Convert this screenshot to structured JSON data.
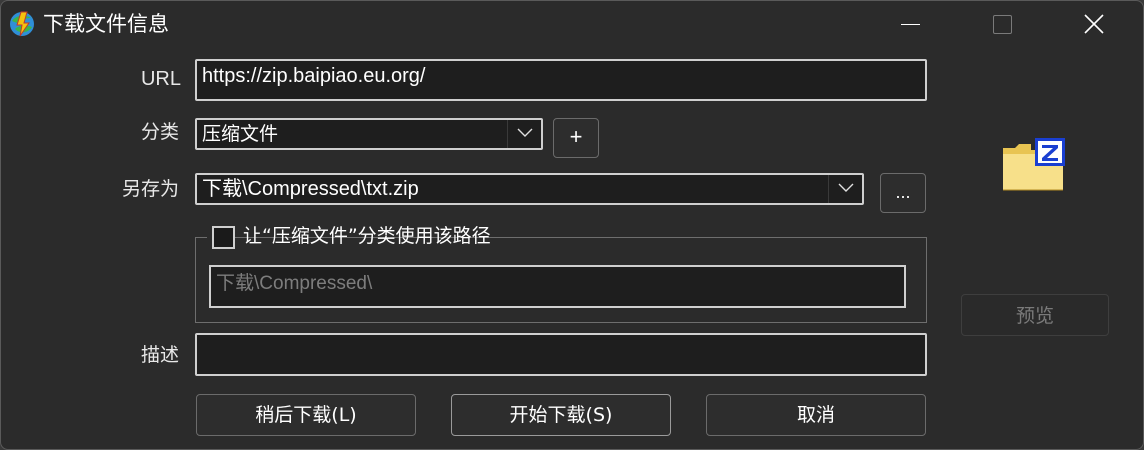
{
  "window": {
    "title": "下载文件信息",
    "icon": "idm-globe-icon"
  },
  "form": {
    "url_label": "URL",
    "url_value": "https://zip.baipiao.eu.org/",
    "category_label": "分类",
    "category_value": "压缩文件",
    "add_category_label": "+",
    "save_as_label": "另存为",
    "save_as_value": "下载\\Compressed\\txt.zip",
    "browse_label": "...",
    "remember_path_label": "让“压缩文件”分类使用该路径",
    "remember_path_checked": false,
    "category_path_value": "下载\\Compressed\\",
    "description_label": "描述",
    "description_value": ""
  },
  "buttons": {
    "download_later": "稍后下载(L)",
    "start_download": "开始下载(S)",
    "cancel": "取消",
    "preview": "预览"
  },
  "file_icon": "zip-folder-icon"
}
